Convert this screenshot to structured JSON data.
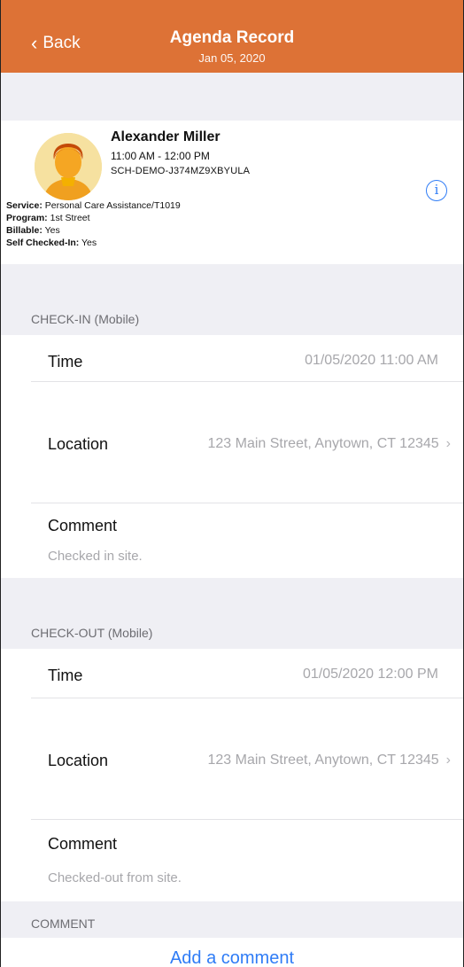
{
  "nav": {
    "back_label": "Back",
    "back_chevron": "‹",
    "title": "Agenda Record",
    "subtitle": "Jan 05, 2020",
    "color": "#dd7236"
  },
  "client": {
    "name": "Alexander Miller",
    "time_range": "11:00 AM - 12:00 PM",
    "schedule_id": "SCH-DEMO-J374MZ9XBYULA",
    "info_icon": "info-circle-icon",
    "info_glyph": "i",
    "service_label": "Service:",
    "service_value": "Personal Care Assistance/T1019",
    "program_label": "Program:",
    "program_value": "1st Street",
    "billable_label": "Billable:",
    "billable_value": "Yes",
    "self_checked_label": "Self Checked-In:",
    "self_checked_value": "Yes"
  },
  "checkin": {
    "header": "CHECK-IN (Mobile)",
    "time_label": "Time",
    "time_value": "01/05/2020 11:00 AM",
    "location_label": "Location",
    "location_value": "123 Main Street, Anytown, CT 12345",
    "comment_label": "Comment",
    "comment_value": "Checked in site."
  },
  "checkout": {
    "header": "CHECK-OUT (Mobile)",
    "time_label": "Time",
    "time_value": "01/05/2020 12:00 PM",
    "location_label": "Location",
    "location_value": "123 Main Street, Anytown, CT 12345",
    "comment_label": "Comment",
    "comment_value": "Checked-out from site."
  },
  "comment_section": {
    "header": "COMMENT",
    "add_label": "Add a comment"
  },
  "chevron_right": "›",
  "accent": "#2f7cf6"
}
